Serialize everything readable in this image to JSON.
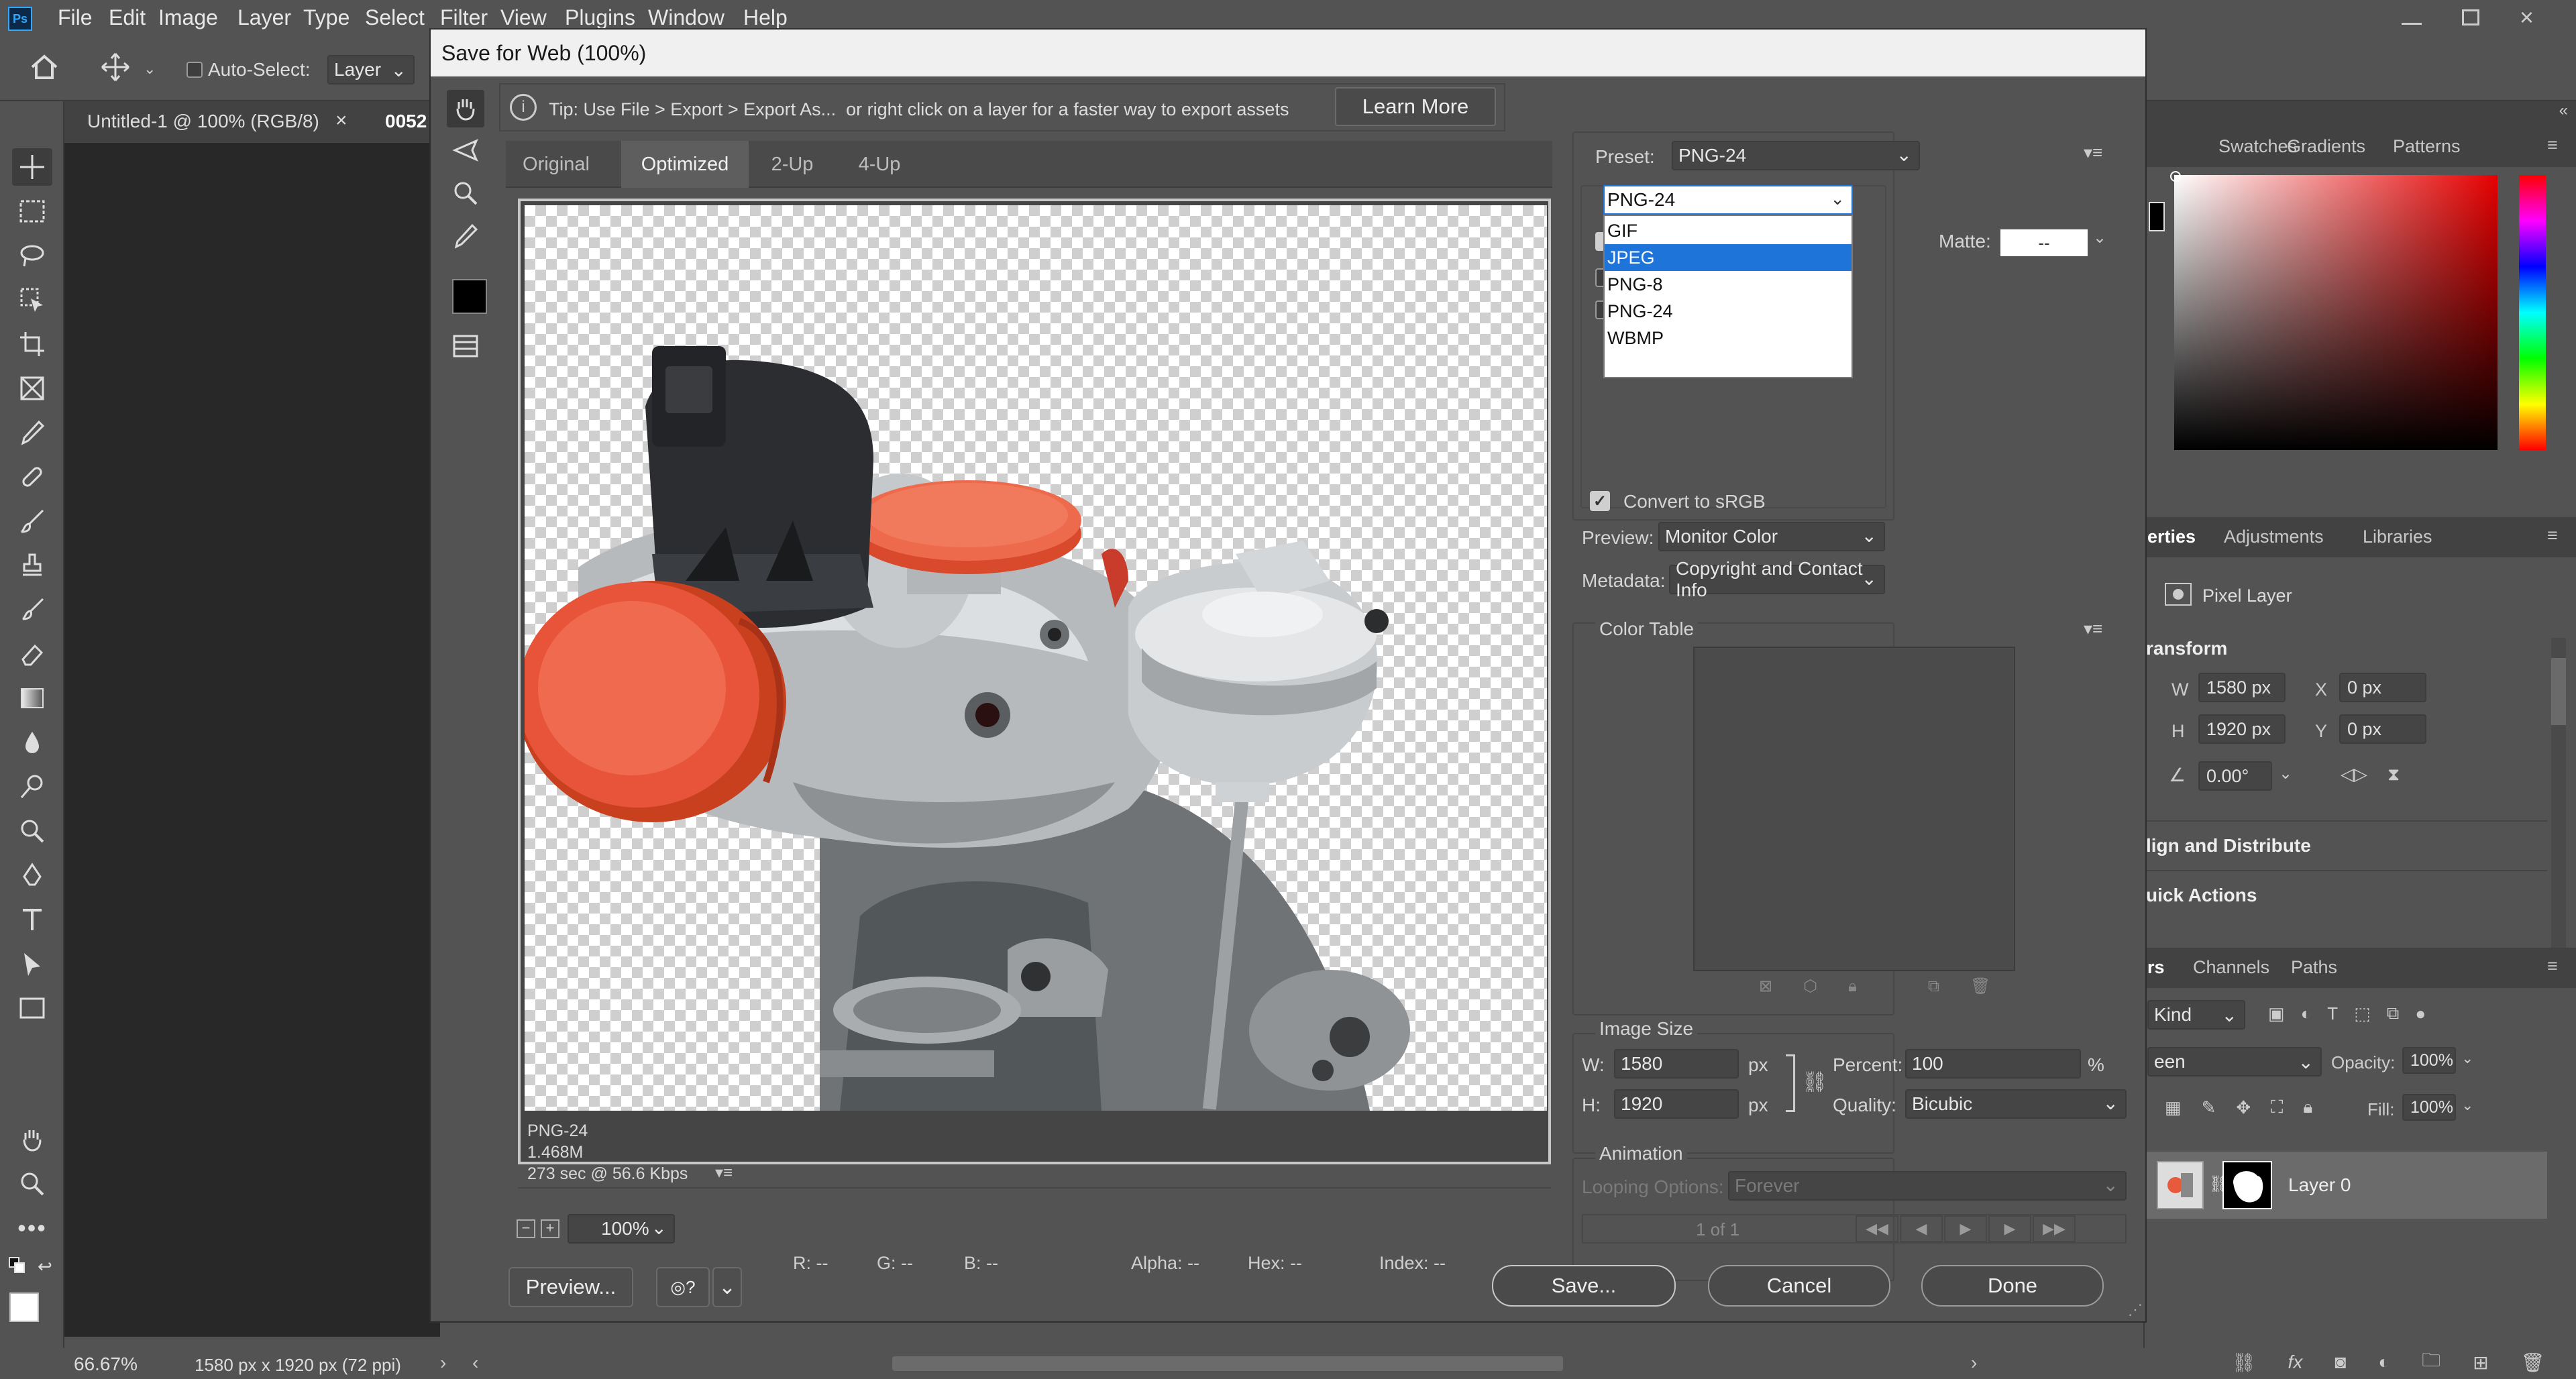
{
  "app": {
    "menu": [
      "File",
      "Edit",
      "Image",
      "Layer",
      "Type",
      "Select",
      "Filter",
      "View",
      "Plugins",
      "Window",
      "Help"
    ],
    "options_bar": {
      "auto_select_label": "Auto-Select:",
      "layer_value": "Layer"
    },
    "doc_tabs": [
      "Untitled-1 @ 100% (RGB/8)",
      "0052"
    ],
    "status": {
      "zoom": "66.67%",
      "doc_info": "1580 px x 1920 px (72 ppi)"
    }
  },
  "panels": {
    "color_tabs": [
      "Swatches",
      "Gradients",
      "Patterns"
    ],
    "props_tabs": [
      "erties",
      "Adjustments",
      "Libraries"
    ],
    "pixel_layer": "Pixel Layer",
    "transform_title": "ransform",
    "w_label": "W",
    "w_value": "1580 px",
    "x_label": "X",
    "x_value": "0 px",
    "h_label": "H",
    "h_value": "1920 px",
    "y_label": "Y",
    "y_value": "0 px",
    "angle_value": "0.00°",
    "align_title": "lign and Distribute",
    "quick_title": "uick Actions",
    "layers_tabs": [
      "rs",
      "Channels",
      "Paths"
    ],
    "kind_value": "Kind",
    "blend_value": "een",
    "opacity_label": "Opacity:",
    "opacity_value": "100%",
    "fill_label": "Fill:",
    "fill_value": "100%",
    "layer_name": "Layer 0"
  },
  "dialog": {
    "title": "Save for Web (100%)",
    "tip": "Tip: Use File > Export > Export As...  or right click on a layer for a faster way to export assets",
    "learn_more": "Learn More",
    "view_tabs": [
      "Original",
      "Optimized",
      "2-Up",
      "4-Up"
    ],
    "image_info": [
      "PNG-24",
      "1.468M",
      "273 sec @ 56.6 Kbps"
    ],
    "zoom_value": "100%",
    "readouts": {
      "r": "R: --",
      "g": "G: --",
      "b": "B: --",
      "alpha": "Alpha: --",
      "hex": "Hex: --",
      "index": "Index: --"
    },
    "preset_label": "Preset:",
    "preset_value": "PNG-24",
    "format_value": "PNG-24",
    "format_options": [
      "GIF",
      "JPEG",
      "PNG-8",
      "PNG-24",
      "WBMP"
    ],
    "format_highlighted": "JPEG",
    "matte_label": "Matte:",
    "matte_value": "--",
    "convert_srgb": "Convert to sRGB",
    "preview_label": "Preview:",
    "preview_value": "Monitor Color",
    "metadata_label": "Metadata:",
    "metadata_value": "Copyright and Contact Info",
    "color_table": "Color Table",
    "image_size": "Image Size",
    "w_label": "W:",
    "w_value": "1580",
    "px1": "px",
    "h_label": "H:",
    "h_value": "1920",
    "px2": "px",
    "percent_label": "Percent:",
    "percent_value": "100",
    "percent_unit": "%",
    "quality_label": "Quality:",
    "quality_value": "Bicubic",
    "animation": "Animation",
    "looping_label": "Looping Options:",
    "looping_value": "Forever",
    "frame_count": "1 of 1",
    "preview_btn": "Preview...",
    "save_btn": "Save...",
    "cancel_btn": "Cancel",
    "done_btn": "Done"
  },
  "colors": {
    "accent": "#1e74d8",
    "checker": "#cfcfcf"
  }
}
